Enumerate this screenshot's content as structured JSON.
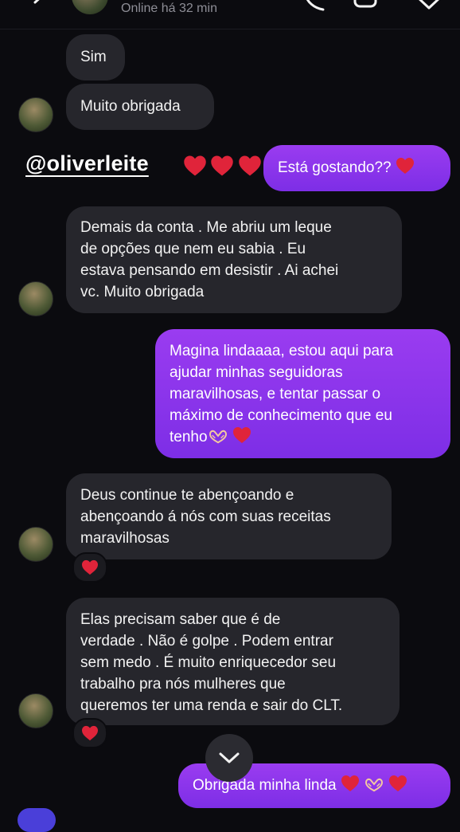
{
  "header": {
    "status": "Online há 32 min"
  },
  "mention": {
    "handle": "@oliverleite"
  },
  "messages": {
    "m1": "Sim",
    "m2": "Muito obrigada",
    "m3": "Está gostando??",
    "m4_l1": "Demais da conta . Me abriu um leque",
    "m4_l2": "de opções que nem eu sabia . Eu",
    "m4_l3": "estava pensando em desistir . Ai achei",
    "m4_l4": "vc. Muito obrigada",
    "m5_l1": "Magina lindaaaa, estou aqui para",
    "m5_l2": "ajudar minhas seguidoras",
    "m5_l3": "maravilhosas, e tentar passar o",
    "m5_l4": "máximo de conhecimento que eu",
    "m5_l5": "tenho",
    "m6_l1": "Deus continue te abençoando e",
    "m6_l2": "abençoando á nós com suas receitas",
    "m6_l3": "maravilhosas",
    "m7_l1": "Elas precisam saber que é de",
    "m7_l2": "verdade . Não é golpe . Podem entrar",
    "m7_l3": "sem medo . É muito enriquecedor seu",
    "m7_l4": "trabalho pra nós mulheres que",
    "m7_l5": "queremos ter uma renda e sair do CLT.",
    "m8": "Obrigada minha linda"
  },
  "icons": {
    "heart_color": "#e0243a",
    "hands": "heart-hands-icon"
  },
  "colors": {
    "outgoing": "#8a2be2",
    "incoming": "#26262c",
    "background": "#0b0b0f"
  }
}
